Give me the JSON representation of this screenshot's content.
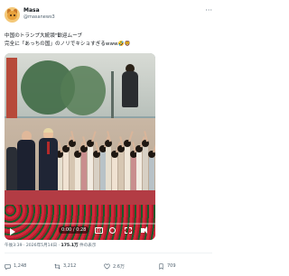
{
  "author": {
    "name": "Masa",
    "handle": "@masanews3"
  },
  "tweet": {
    "line1": "中国のトランプ大統領\"歓迎ムーブ",
    "line2": "完全に「あっちの国」のノリでキショすぎるwww🤣🦁"
  },
  "video": {
    "timecode": "0:00 / 0:28",
    "progress": 0.0,
    "cc_label": "CC"
  },
  "meta": {
    "time": "午後3:39 · 2026年5月14日 · ",
    "views_count": "175.1万",
    "views_label": " 件の表示"
  },
  "actions": {
    "replies": "1,248",
    "retweets": "3,212",
    "likes": "2.6万",
    "bookmarks": "709"
  },
  "colors": {
    "accent": "#1d9bf0",
    "text": "#0f1419",
    "muted": "#536471"
  }
}
